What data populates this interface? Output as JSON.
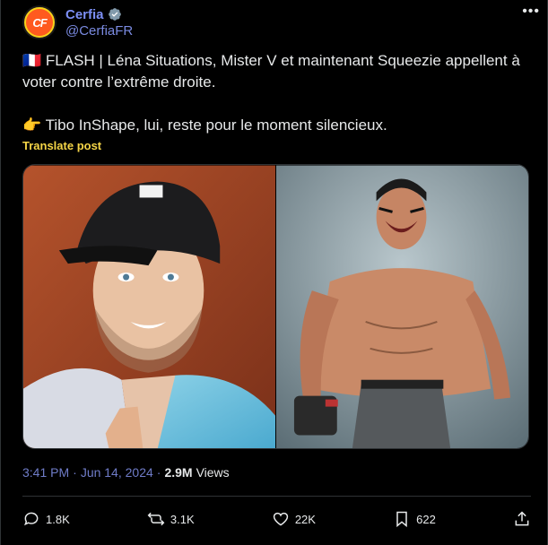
{
  "author": {
    "display_name": "Cerfia",
    "handle": "@CerfiaFR",
    "avatar_text": "CF",
    "verified_icon": "verified-badge-icon"
  },
  "post": {
    "line1": "🇫🇷 FLASH | Léna Situations, Mister V et maintenant Squeezie appellent à voter contre l’extrême droite.",
    "line2": "👉 Tibo InShape, lui, reste pour le moment silencieux.",
    "translate_label": "Translate post"
  },
  "meta": {
    "time": "3:41 PM",
    "separator": "·",
    "date": "Jun 14, 2024",
    "separator2": "·",
    "views_count": "2.9M",
    "views_label": "Views"
  },
  "actions": {
    "replies": "1.8K",
    "reposts": "3.1K",
    "likes": "22K",
    "bookmarks": "622"
  },
  "colors": {
    "background": "#000000",
    "name": "#7c8ff5",
    "link": "#6f7cc8",
    "translate": "#f5d547",
    "text": "#e7e9ea",
    "divider": "#2f3336"
  },
  "icons": [
    "more-icon",
    "verified-badge-icon",
    "reply-icon",
    "repost-icon",
    "like-icon",
    "bookmark-icon",
    "share-icon"
  ]
}
